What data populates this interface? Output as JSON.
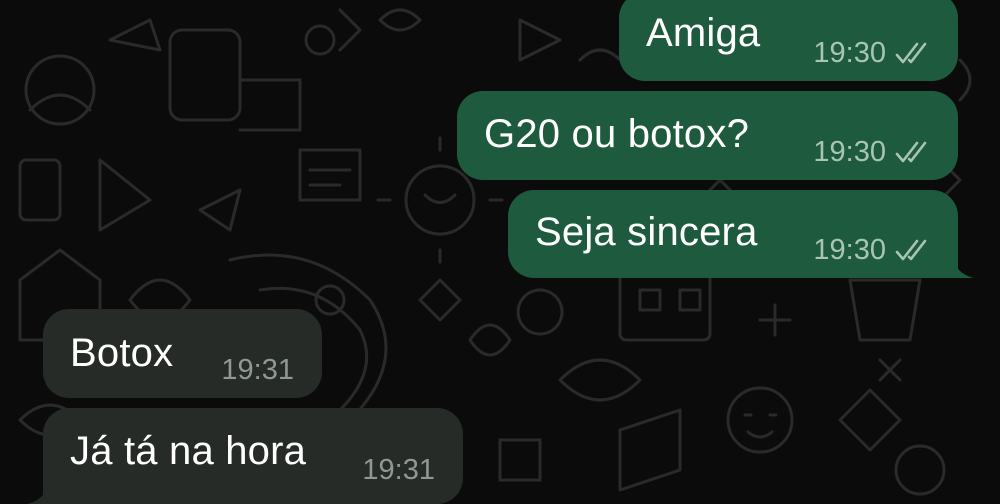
{
  "colors": {
    "background": "#0b0b0b",
    "outgoing_bubble": "#1e5b3e",
    "incoming_bubble": "#262b28",
    "time_outgoing": "#a9c4b5",
    "time_incoming": "#8f9893",
    "read_ticks": "#a9c4b5"
  },
  "messages": [
    {
      "direction": "outgoing",
      "text": "Amiga",
      "time": "19:30",
      "status": "read",
      "status_icon": "double-check-icon"
    },
    {
      "direction": "outgoing",
      "text": "G20 ou botox?",
      "time": "19:30",
      "status": "read",
      "status_icon": "double-check-icon"
    },
    {
      "direction": "outgoing",
      "text": "Seja sincera",
      "time": "19:30",
      "status": "read",
      "status_icon": "double-check-icon"
    },
    {
      "direction": "incoming",
      "text": "Botox",
      "time": "19:31"
    },
    {
      "direction": "incoming",
      "text": "Já tá na hora",
      "time": "19:31"
    }
  ]
}
